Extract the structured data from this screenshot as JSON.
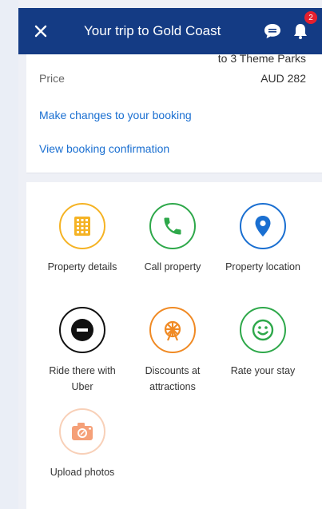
{
  "header": {
    "title": "Your trip to Gold Coast",
    "notification_count": "2"
  },
  "summary": {
    "cut_off_text": "to 3 Theme Parks",
    "price_label": "Price",
    "price_value": "AUD 282",
    "change_link": "Make changes to your booking",
    "confirmation_link": "View booking confirmation"
  },
  "actions": [
    {
      "label": "Property details",
      "icon": "building-icon",
      "color": "#f5b324"
    },
    {
      "label": "Call property",
      "icon": "phone-icon",
      "color": "#2ea84a"
    },
    {
      "label": "Property location",
      "icon": "location-pin-icon",
      "color": "#1a6fd1"
    },
    {
      "label": "Ride there with Uber",
      "icon": "uber-icon",
      "color": "#111111"
    },
    {
      "label": "Discounts at attractions",
      "icon": "ferris-wheel-icon",
      "color": "#f08a24"
    },
    {
      "label": "Rate your stay",
      "icon": "smiley-icon",
      "color": "#2ea84a"
    },
    {
      "label": "Upload photos",
      "icon": "camera-icon",
      "color": "#f5a078"
    }
  ]
}
